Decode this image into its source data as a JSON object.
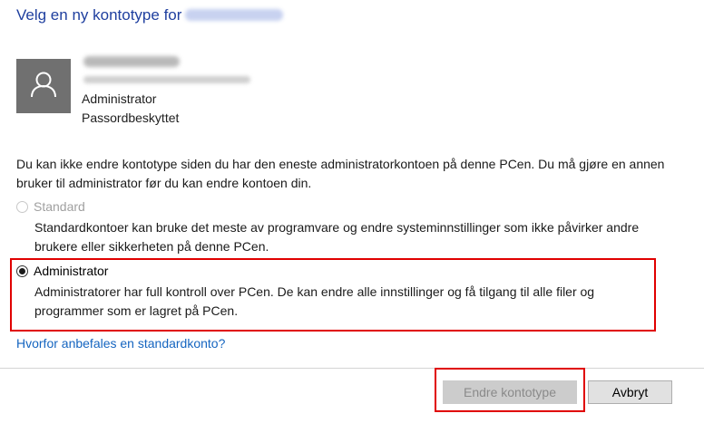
{
  "dialog": {
    "title_prefix": "Velg en ny kontotype for"
  },
  "account": {
    "avatar_icon": "user-icon",
    "type": "Administrator",
    "password_status": "Passordbeskyttet"
  },
  "notice": "Du kan ikke endre kontotype siden du har den eneste administratorkontoen på denne PCen. Du må gjøre en annen bruker til administrator før du kan endre kontoen din.",
  "options": [
    {
      "label": "Standard",
      "description": "Standardkontoer kan bruke det meste av programvare og endre systeminnstillinger som ikke påvirker andre brukere eller sikkerheten på denne PCen.",
      "selected": false,
      "enabled": false
    },
    {
      "label": "Administrator",
      "description": "Administratorer har full kontroll over PCen. De kan endre alle innstillinger og få tilgang til alle filer og programmer som er lagret på PCen.",
      "selected": true,
      "enabled": true
    }
  ],
  "help_link": "Hvorfor anbefales en standardkonto?",
  "buttons": {
    "change": "Endre kontotype",
    "cancel": "Avbryt"
  },
  "colors": {
    "title": "#1f3f9f",
    "link": "#1565c0",
    "highlight": "#e00000"
  }
}
